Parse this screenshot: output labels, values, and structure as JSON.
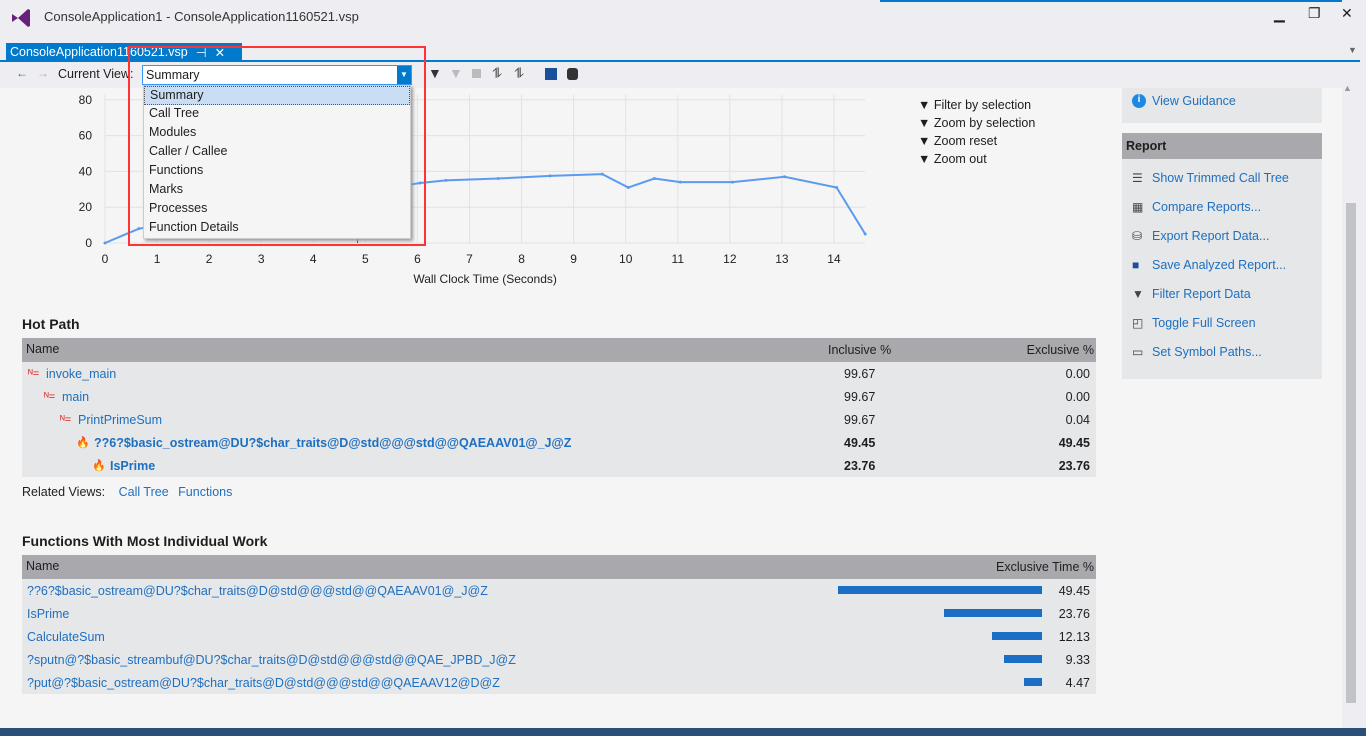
{
  "window": {
    "title": "ConsoleApplication1 - ConsoleApplication1160521.vsp",
    "min": "▁",
    "restore": "❐",
    "close": "✕"
  },
  "tab": {
    "label": "ConsoleApplication1160521.vsp",
    "pin": "⊣",
    "close": "✕"
  },
  "toolbar": {
    "back": "←",
    "forward": "→",
    "current_view_label": "Current View:",
    "current_view_value": "Summary"
  },
  "dropdown_options": [
    "Summary",
    "Call Tree",
    "Modules",
    "Caller / Callee",
    "Functions",
    "Marks",
    "Processes",
    "Function Details"
  ],
  "chart_data": {
    "type": "line",
    "xlabel": "Wall Clock Time (Seconds)",
    "ylabel": "",
    "xlim": [
      0,
      14.6
    ],
    "ylim": [
      0,
      80
    ],
    "xticks": [
      "0",
      "1",
      "2",
      "3",
      "4",
      "5",
      "6",
      "7",
      "8",
      "9",
      "10",
      "11",
      "12",
      "13",
      "14"
    ],
    "yticks": [
      "0",
      "20",
      "40",
      "60",
      "80"
    ],
    "x": [
      0,
      0.65,
      6.05,
      6.55,
      7.55,
      8.55,
      9.55,
      10.05,
      10.55,
      11.05,
      12.05,
      13.05,
      14.05,
      14.6
    ],
    "y": [
      0,
      8,
      33.5,
      35,
      36,
      37.5,
      38.5,
      31,
      36,
      34,
      34,
      37,
      31,
      5
    ],
    "grid": true,
    "color": "#5b9bef",
    "marker_x": 4.85
  },
  "chart_actions": [
    "Filter by selection",
    "Zoom by selection",
    "Zoom reset",
    "Zoom out"
  ],
  "hot_path": {
    "title": "Hot Path",
    "columns": [
      "Name",
      "Inclusive %",
      "Exclusive %"
    ],
    "rows": [
      {
        "name": "invoke_main",
        "inc": "99.67",
        "exc": "0.00",
        "hot": false
      },
      {
        "name": "main",
        "inc": "99.67",
        "exc": "0.00",
        "hot": false
      },
      {
        "name": "PrintPrimeSum",
        "inc": "99.67",
        "exc": "0.04",
        "hot": false
      },
      {
        "name": "??6?$basic_ostream@DU?$char_traits@D@std@@@std@@QAEAAV01@_J@Z",
        "inc": "49.45",
        "exc": "49.45",
        "hot": true
      },
      {
        "name": "IsPrime",
        "inc": "23.76",
        "exc": "23.76",
        "hot": true
      }
    ],
    "related_label": "Related Views:",
    "related": [
      "Call Tree",
      "Functions"
    ]
  },
  "functions": {
    "title": "Functions With Most Individual Work",
    "columns": [
      "Name",
      "Exclusive Time %"
    ],
    "rows": [
      {
        "name": "??6?$basic_ostream@DU?$char_traits@D@std@@@std@@QAEAAV01@_J@Z",
        "value": "49.45",
        "pct": 49.45
      },
      {
        "name": "IsPrime",
        "value": "23.76",
        "pct": 23.76
      },
      {
        "name": "CalculateSum",
        "value": "12.13",
        "pct": 12.13
      },
      {
        "name": "?sputn@?$basic_streambuf@DU?$char_traits@D@std@@@std@@QAE_JPBD_J@Z",
        "value": "9.33",
        "pct": 9.33
      },
      {
        "name": "?put@?$basic_ostream@DU?$char_traits@D@std@@@std@@QAEAAV12@D@Z",
        "value": "4.47",
        "pct": 4.47
      }
    ]
  },
  "right_panel": {
    "guidance": "View Guidance",
    "report_title": "Report",
    "items": [
      "Show Trimmed Call Tree",
      "Compare Reports...",
      "Export Report Data...",
      "Save Analyzed Report...",
      "Filter Report Data",
      "Toggle Full Screen",
      "Set Symbol Paths..."
    ]
  },
  "colors": {
    "accent": "#007acc",
    "bar": "#1a6fc4",
    "link": "#1e6fc0",
    "annotation": "#ff3333"
  }
}
